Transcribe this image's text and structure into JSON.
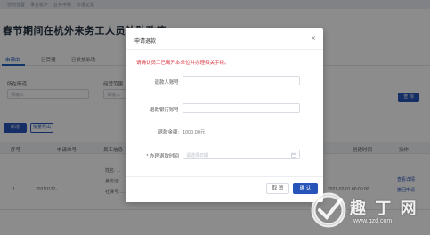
{
  "breadcrumb": [
    "您的位置",
    "事业帐户",
    "业务申报",
    "办理记录"
  ],
  "page": {
    "title": "春节期间在杭外来务工人员补助政策"
  },
  "tabs": [
    {
      "label": "申请中"
    },
    {
      "label": "已受理"
    },
    {
      "label": "已发放补助"
    }
  ],
  "filters": [
    {
      "label": "所在街道",
      "placeholder": "请输入"
    },
    {
      "label": "经营范围",
      "placeholder": "请输入"
    }
  ],
  "actions": {
    "search_label": "查 询",
    "new_label": "新增",
    "export_label": "批量导出"
  },
  "table": {
    "columns": [
      "序号",
      "申请单号",
      "员工信息",
      "",
      "",
      "",
      "",
      "创建时间",
      "操作"
    ],
    "rows": [
      {
        "index": "1",
        "order_no": "20210127-...",
        "info_lines": [
          "姓名: ...",
          "身份证: ...",
          "社保号: ..."
        ],
        "created": "2021-02-01 00:00:00",
        "ops": [
          "查看详情",
          "撤回申请"
        ]
      }
    ]
  },
  "modal": {
    "title": "申请退款",
    "close_glyph": "×",
    "warning": "请确认员工已离开本单位并办理相关手续。",
    "fields": {
      "payee_label": "退款人账号",
      "payee_placeholder": "",
      "bank_label": "退款银行账号",
      "bank_placeholder": "",
      "amount_label": "退款金额:",
      "amount_value": "1000.00元",
      "date_label": "* 办理退款时间",
      "date_placeholder": "请选择日期"
    },
    "cancel_label": "取 消",
    "ok_label": "确 认"
  },
  "watermark": {
    "text": "趣 丁 网",
    "url": "www.qzd.com"
  },
  "colors": {
    "primary": "#2754b8",
    "warning": "#d9363e",
    "mask": "rgba(0,0,0,0.45)"
  }
}
